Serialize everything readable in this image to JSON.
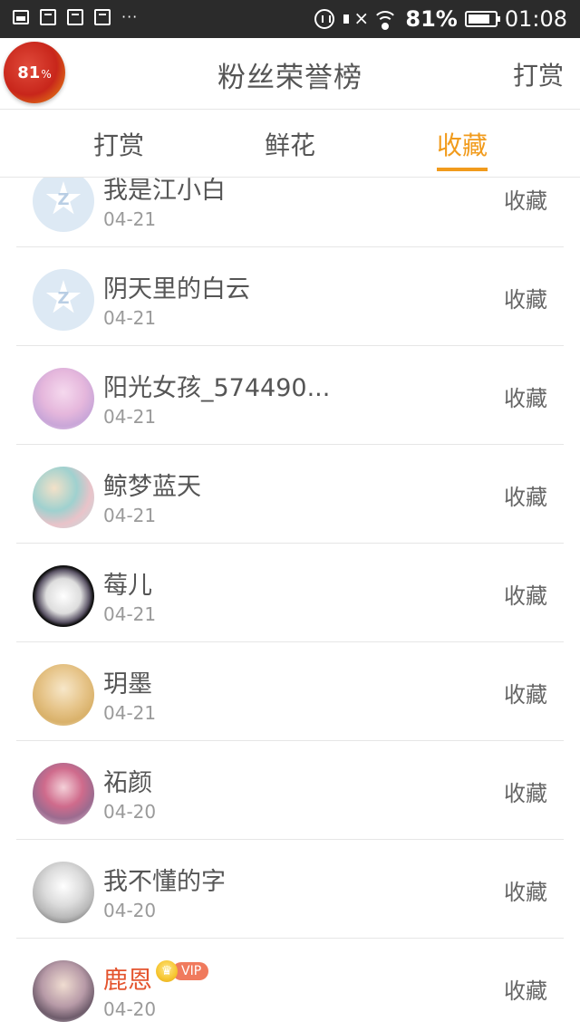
{
  "status_bar": {
    "dots": "···",
    "battery_pct": "81%",
    "battery_level": 0.81,
    "time": "01:08",
    "icons": [
      "gallery-icon",
      "package-icon",
      "package-icon",
      "package-icon",
      "vibrate-icon",
      "mute-icon",
      "wifi-icon",
      "battery-icon"
    ]
  },
  "header": {
    "badge_value": "81",
    "badge_unit": "%",
    "title": "粉丝荣誉榜",
    "action": "打赏"
  },
  "tabs": [
    {
      "label": "打赏",
      "active": false
    },
    {
      "label": "鲜花",
      "active": false
    },
    {
      "label": "收藏",
      "active": true
    }
  ],
  "accent_color": "#f19b1c",
  "list": [
    {
      "name": "我是江小白",
      "date": "04-21",
      "action": "收藏",
      "vip": false
    },
    {
      "name": "阴天里的白云",
      "date": "04-21",
      "action": "收藏",
      "vip": false
    },
    {
      "name": "阳光女孩_574490...",
      "date": "04-21",
      "action": "收藏",
      "vip": false
    },
    {
      "name": "鲸梦蓝天",
      "date": "04-21",
      "action": "收藏",
      "vip": false
    },
    {
      "name": "莓儿",
      "date": "04-21",
      "action": "收藏",
      "vip": false
    },
    {
      "name": "玥墨",
      "date": "04-21",
      "action": "收藏",
      "vip": false
    },
    {
      "name": "祏颜",
      "date": "04-20",
      "action": "收藏",
      "vip": false
    },
    {
      "name": "我不懂的字",
      "date": "04-20",
      "action": "收藏",
      "vip": false
    },
    {
      "name": "鹿恩",
      "date": "04-20",
      "action": "收藏",
      "vip": true,
      "vip_label": "VIP"
    }
  ]
}
